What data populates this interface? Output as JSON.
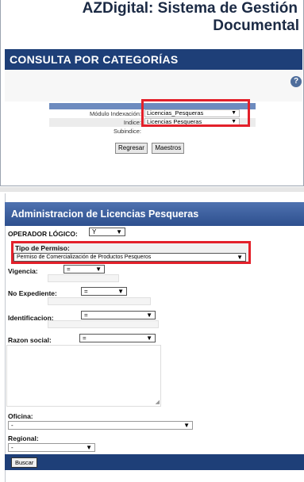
{
  "app_title": {
    "line1": "AZDigital: Sistema de Gestión",
    "line2": "Documental"
  },
  "page_title": "CONSULTA POR CATEGORÍAS",
  "help_icon": "?",
  "search_panel": {
    "rows": [
      {
        "label": "Módulo Indexación:",
        "value": "Licencias_Pesqueras"
      },
      {
        "label": "Indice:",
        "value": "Licencias Pesqueras"
      },
      {
        "label": "Subindice:",
        "value": ""
      }
    ],
    "buttons": {
      "back": "Regresar",
      "masters": "Maestros"
    }
  },
  "section_title": "Administracion de Licencias Pesqueras",
  "form": {
    "operator": {
      "label": "OPERADOR LÓGICO:",
      "value": "Y"
    },
    "tipo": {
      "label": "Tipo de Permiso:",
      "value": "Permiso de Comercialización de Productos Pesqueros"
    },
    "vigencia": {
      "label": "Vigencia:",
      "op": "="
    },
    "expediente": {
      "label": "No Expediente:",
      "op": "="
    },
    "identificacion": {
      "label": "Identificacion:",
      "op": "="
    },
    "razon": {
      "label": "Razon social:",
      "op": "="
    },
    "oficina": {
      "label": "Oficina:",
      "value": "-"
    },
    "regional": {
      "label": "Regional:",
      "value": "-"
    },
    "search_label": "Buscar"
  },
  "colors": {
    "header_blue": "#1e3f78",
    "highlight_red": "#e3202a"
  },
  "icons": {
    "dropdown": "chevron-down-icon",
    "help": "question-icon"
  }
}
